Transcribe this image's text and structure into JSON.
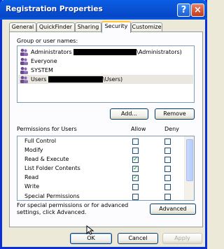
{
  "window": {
    "title": "Registration Properties"
  },
  "titlebar": {
    "help_icon": "?",
    "close_icon": "×"
  },
  "tabs": [
    {
      "label": "General",
      "active": false
    },
    {
      "label": "QuickFinder",
      "active": false
    },
    {
      "label": "Sharing",
      "active": false
    },
    {
      "label": "Security",
      "active": true
    },
    {
      "label": "Customize",
      "active": false
    }
  ],
  "security": {
    "group_label": "Group or user names:",
    "users": [
      {
        "prefix": "Administrators",
        "suffix": "\\Administrators)",
        "icon": "users-group-icon"
      },
      {
        "prefix": "Everyone",
        "suffix": "",
        "icon": "users-group-icon"
      },
      {
        "prefix": "SYSTEM",
        "suffix": "",
        "icon": "users-group-icon"
      },
      {
        "prefix": "Users",
        "suffix": "\\Users)",
        "icon": "users-group-icon",
        "selected": true
      }
    ],
    "add_button": "Add...",
    "remove_button": "Remove",
    "permissions_label": "Permissions for Users",
    "allow_header": "Allow",
    "deny_header": "Deny",
    "permissions": [
      {
        "name": "Full Control",
        "allow": false,
        "deny": false
      },
      {
        "name": "Modify",
        "allow": false,
        "deny": false
      },
      {
        "name": "Read & Execute",
        "allow": true,
        "deny": false
      },
      {
        "name": "List Folder Contents",
        "allow": true,
        "deny": false
      },
      {
        "name": "Read",
        "allow": true,
        "deny": false
      },
      {
        "name": "Write",
        "allow": false,
        "deny": false
      },
      {
        "name": "Special Permissions",
        "allow": false,
        "deny": false
      }
    ],
    "special_note": "For special permissions or for advanced settings, click Advanced.",
    "advanced_button": "Advanced"
  },
  "footer": {
    "ok_button": "OK",
    "cancel_button": "Cancel",
    "apply_button": "Apply"
  }
}
